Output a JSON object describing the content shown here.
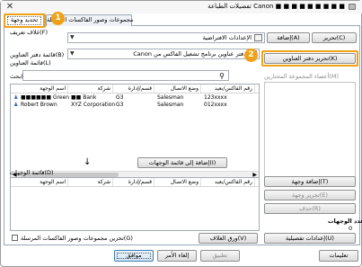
{
  "window": {
    "title": "تفضيلات الطباعة Canon ■ ■ ■ ■ ■ ■ ■ ■ ■",
    "close_glyph": "✕"
  },
  "tabs": [
    {
      "label": "تحديد وجهة",
      "active": true
    },
    {
      "label": "مجموعات وصور الفاكسات المرسلة",
      "active": false
    }
  ],
  "top": {
    "cover_label": "(F)غلاف تعريف",
    "cover_value": "الإعدادات الافتراضية",
    "add_button": "(A)إضافة",
    "edit_button": "(C)تحرير"
  },
  "address_book": {
    "source_text": "دفتر عناوين برنامج تشغيل الفاكس من Canon",
    "list_label": "(B)قائمة دفتر العناوين",
    "addresses_label": "(L)قائمة العناوين",
    "search_label": "(S)بحث",
    "edit_button": "(K)تحرير دفتر العناوين",
    "group_members_label": "(M)أعضاء المجموعة المختارين",
    "columns": [
      "رقم الفاكس/بعيد",
      "وضع الاتصال",
      "قسم/إدارة",
      "شركة",
      "اسم الوجهة"
    ],
    "rows": [
      {
        "name": "■■■■■■ Green",
        "company": "■■ Bank",
        "dept": "G3",
        "mode": "Salesman",
        "fax": "123xxxx"
      },
      {
        "name": "Robert Brown",
        "company": "XYZ Corporation",
        "dept": "G3",
        "mode": "Salesman",
        "fax": "012xxxx"
      }
    ]
  },
  "add_to_list_button": "(I)إضافة إلى قائمة الوجهات",
  "destinations": {
    "label": "(D)قائمة الوجهات",
    "columns": [
      "رقم الفاكس/بعيد",
      "وضع الاتصال",
      "قسم/إدارة",
      "شركة",
      "اسم الوجهة"
    ],
    "add_button": "(T)إضافة وجهة",
    "edit_button": "(E)تحرير وجهة",
    "delete_button": "(R)حذف",
    "count_label": "عدد الوجهات",
    "count_value": "0"
  },
  "bottom": {
    "store_checkbox_label": "(G)تخزين مجموعات وصور الفاكسات المرسلة",
    "detail_button": "(U)إعدادات تفصيلية",
    "cover_button": "(V)ورق الغلاف"
  },
  "footer": {
    "ok": "موافق",
    "cancel": "إلغاء الأمر",
    "apply": "تطبيق",
    "help": "تعليمات"
  },
  "badges": [
    "1",
    "2"
  ],
  "colors": {
    "badge": "#f0a117",
    "focus": "#3c7fb1"
  }
}
